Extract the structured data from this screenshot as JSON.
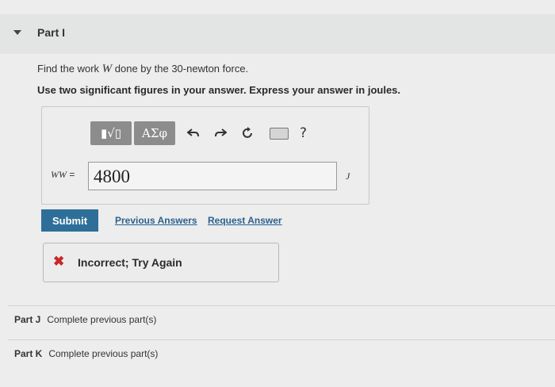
{
  "part": {
    "title": "Part I",
    "caret_icon": "caret-down-icon"
  },
  "question": {
    "text_before": "Find the work ",
    "variable": "W",
    "text_after": " done by the 30-newton force.",
    "instruction": "Use two significant figures in your answer. Express your answer in joules."
  },
  "toolbar": {
    "templates_label": "▮√▯",
    "greek_label": "ΑΣφ",
    "undo_icon": "undo-icon",
    "redo_icon": "redo-icon",
    "reset_icon": "reset-icon",
    "keyboard_icon": "keyboard-icon",
    "help_label": "?"
  },
  "answer": {
    "variable_label": "WW",
    "equals": " =",
    "value": "4800",
    "unit": "J"
  },
  "actions": {
    "submit_label": "Submit",
    "previous_answers": "Previous Answers",
    "request_answer": "Request Answer"
  },
  "feedback": {
    "icon": "x-icon",
    "status": "incorrect",
    "text": "Incorrect; Try Again",
    "color": "#c62828"
  },
  "other_parts": [
    {
      "name": "Part J",
      "status": "Complete previous part(s)"
    },
    {
      "name": "Part K",
      "status": "Complete previous part(s)"
    }
  ],
  "colors": {
    "submit_bg": "#2e6f99",
    "link": "#2b5f8f",
    "toolbar_button": "#8c8c8c"
  }
}
